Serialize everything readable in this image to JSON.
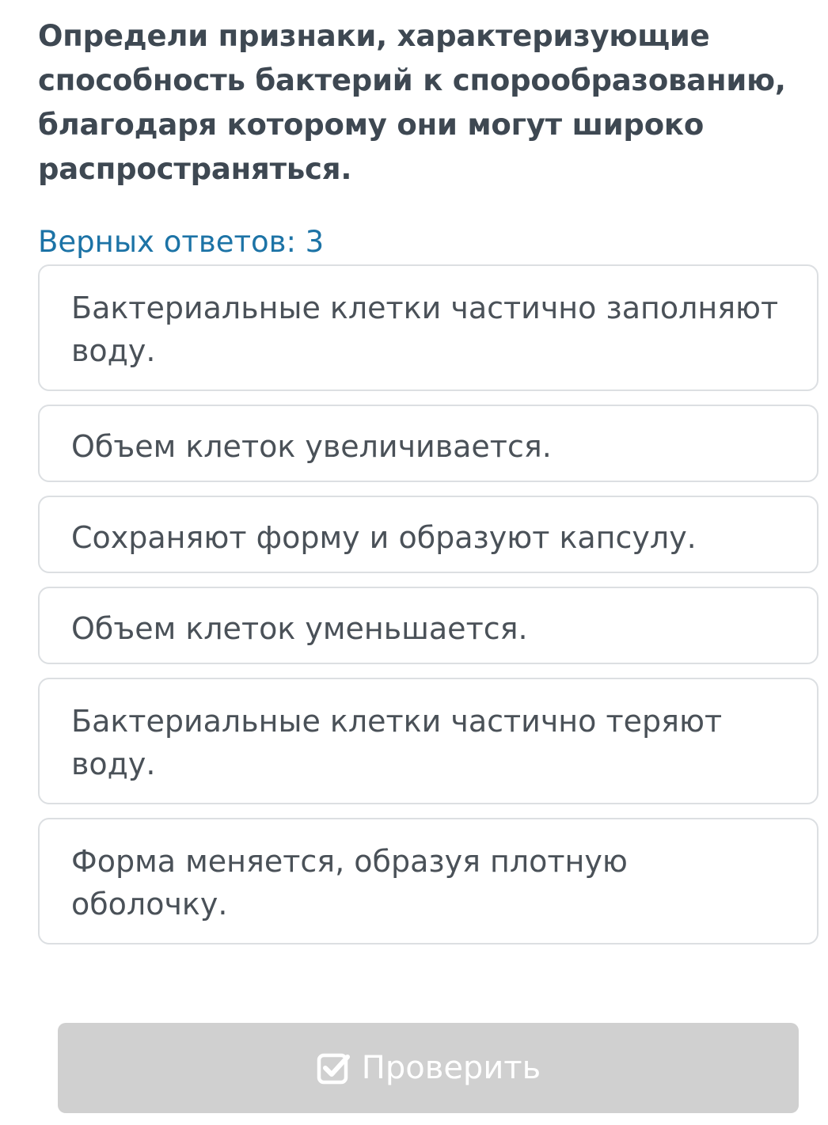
{
  "question": {
    "text": "Определи признаки, характеризующие способность бактерий к спорообразованию, благодаря которому они могут широко распространяться."
  },
  "answers_count_label": "Верных ответов: 3",
  "options": [
    {
      "label": "Бактериальные клетки частично заполняют воду."
    },
    {
      "label": "Объем клеток увеличивается."
    },
    {
      "label": "Сохраняют форму и образуют капсулу."
    },
    {
      "label": "Объем клеток уменьшается."
    },
    {
      "label": "Бактериальные клетки частично теряют воду."
    },
    {
      "label": "Форма меняется, образуя плотную оболочку."
    }
  ],
  "check_button": {
    "label": "Проверить",
    "icon": "checkbox-checked-icon",
    "state": "disabled"
  },
  "colors": {
    "question_text": "#3e4852",
    "count_text": "#1c73a6",
    "option_border": "#dcdfe2",
    "option_text": "#4a5158",
    "button_bg": "#d0d0d0",
    "button_text": "#ffffff"
  }
}
